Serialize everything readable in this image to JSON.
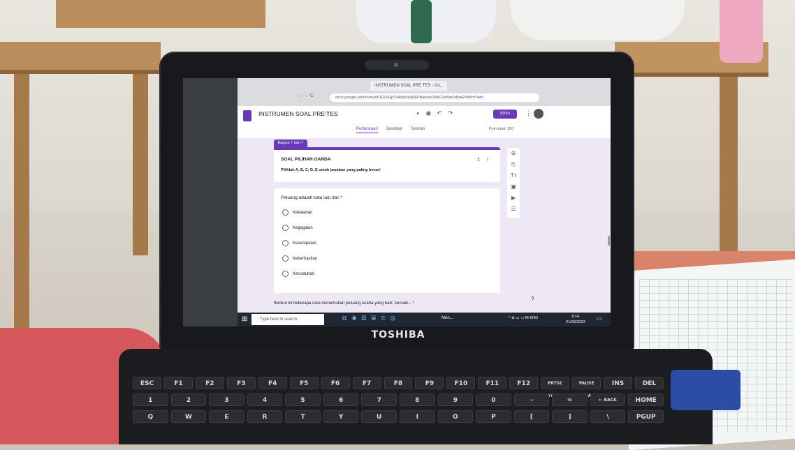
{
  "browser": {
    "tab_title": "INSTRUMEN SOAL PRE TES - Go...",
    "url": "docs.google.com/forms/d/1GDIQp7vAsXp3y8RR/BamanDKKC4af9w2d5nG6vt5hY/edit"
  },
  "form": {
    "title": "INSTRUMEN SOAL PRE TES",
    "send_label": "Kirim",
    "tabs": [
      "Pertanyaan",
      "Jawaban",
      "Setelan"
    ],
    "points": "Poin total: 100",
    "section_tag": "Bagian 7 dari 7",
    "section_title": "SOAL PILIHAN GANDA",
    "section_desc": "Pilihlah A, B, C, D, E untuk jawaban yang paling benar!",
    "question": "Peluang adalah kata lain dari *",
    "options": [
      "Kekalahan",
      "Kegagalan",
      "Kesempatan",
      "Keberhasilan",
      "Keruntuhan"
    ],
    "next_question": "Berikut ini beberapa cara menemukan peluang usaha yang baik, kecuali... *",
    "help_glyph": "?"
  },
  "taskbar": {
    "search_placeholder": "Type here to search",
    "app_label": "Men...",
    "tray": "^ ⊕ ▭ ◁ 46 ENG",
    "time": "8:14",
    "date": "21/08/2023"
  },
  "laptop": {
    "brand": "TOSHIBA"
  },
  "keyboard": {
    "row1": [
      "ESC",
      "F1",
      "F2",
      "F3",
      "F4",
      "F5",
      "F6",
      "F7",
      "F8",
      "F9",
      "F10",
      "F11",
      "F12",
      "PRTSC SYSRQ",
      "PAUSE BREAK",
      "INS",
      "DEL"
    ],
    "row2": [
      "1",
      "2",
      "3",
      "4",
      "5",
      "6",
      "7",
      "8",
      "9",
      "0",
      "-",
      "=",
      "← BACK SPACE",
      "HOME"
    ],
    "row3": [
      "Q",
      "W",
      "E",
      "R",
      "T",
      "Y",
      "U",
      "I",
      "O",
      "P",
      "[",
      "]",
      "\\",
      "PGUP"
    ]
  },
  "icons": {
    "menu": "≡",
    "star": "☆",
    "palette": "◐",
    "eye": "◉",
    "undo": "↶",
    "redo": "↷",
    "more": "⋮",
    "add": "⊕",
    "import": "⎘",
    "text": "Tт",
    "image": "▣",
    "video": "▶",
    "section": "☰",
    "windows": "⊞",
    "search": "⌕",
    "notification": "▭"
  },
  "colors": {
    "accent": "#673ab7",
    "taskbar": "#1f2733",
    "form_bg": "#ede7f6"
  }
}
